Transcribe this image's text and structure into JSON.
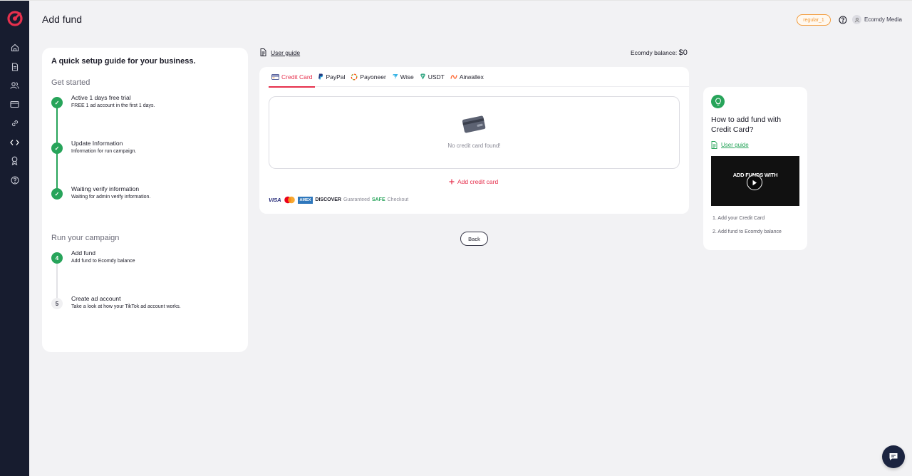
{
  "header": {
    "title": "Add fund",
    "plan_badge": "regular_1",
    "user_name": "Ecomdy Media"
  },
  "sidebar": {
    "items": [
      "home-icon",
      "document-icon",
      "users-icon",
      "card-icon",
      "link-icon",
      "code-icon",
      "award-icon",
      "help-icon"
    ]
  },
  "guide": {
    "title": "A quick setup guide for your business.",
    "section1": "Get started",
    "section2": "Run your campaign",
    "steps": [
      {
        "title": "Active 1 days free trial",
        "desc": "FREE 1 ad account in the first 1 days.",
        "marker": "✓"
      },
      {
        "title": "Update Information",
        "desc": "Information for run campaign.",
        "marker": "✓"
      },
      {
        "title": "Waiting verify information",
        "desc": "Waiting for admin verify information.",
        "marker": "✓"
      },
      {
        "title": "Add fund",
        "desc": "Add fund to Ecomdy balance",
        "marker": "4"
      },
      {
        "title": "Create ad account",
        "desc": "Take a look at how your TikTok ad account works.",
        "marker": "5"
      }
    ]
  },
  "main": {
    "user_guide": "User guide",
    "balance_label": "Ecomdy balance:",
    "balance_value": "$0",
    "tabs": [
      "Credit Card",
      "PayPal",
      "Payoneer",
      "Wise",
      "USDT",
      "Airwallex"
    ],
    "empty_text": "No credit card found!",
    "add_card": "Add credit card",
    "brands": {
      "visa": "VISA",
      "amex": "AMEX",
      "discover": "DISCOVER"
    },
    "guarantee_prefix": "Guaranteed",
    "guarantee_safe": "SAFE",
    "guarantee_suffix": "Checkout",
    "back": "Back"
  },
  "howto": {
    "title": "How to add fund with Credit Card?",
    "user_guide": "User guide",
    "video_text": "ADD FUNDS WITH",
    "steps": [
      "1. Add your Credit Card",
      "2. Add fund to Ecomdy balance"
    ]
  },
  "colors": {
    "accent": "#e6304d",
    "success": "#27a45a",
    "sidebar": "#171c2f",
    "badge": "#f39c3c"
  }
}
